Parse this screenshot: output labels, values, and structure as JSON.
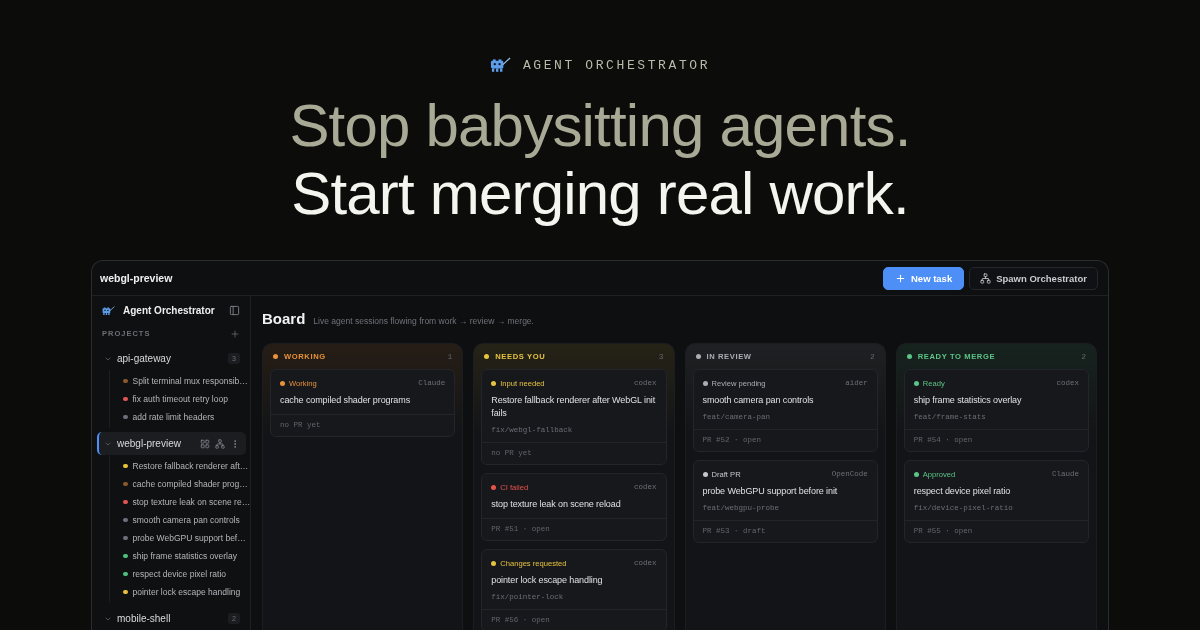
{
  "hero": {
    "brand": "AGENT ORCHESTRATOR",
    "headline": "Stop babysitting agents.",
    "subheadline": "Start merging real work."
  },
  "window": {
    "title": "webgl-preview",
    "buttons": [
      {
        "kind": "primary",
        "label": "New task"
      },
      {
        "kind": "secondary",
        "label": "Spawn Orchestrator"
      }
    ]
  },
  "sidebar": {
    "title": "Agent Orchestrator",
    "section": "PROJECTS",
    "projects": [
      {
        "name": "api-gateway",
        "count": "3",
        "selected": false,
        "sessions": [
          {
            "title": "Split terminal mux responsib…",
            "color": "#8c5a2e"
          },
          {
            "title": "fix auth timeout retry loop",
            "color": "#e05656"
          },
          {
            "title": "add rate limit headers",
            "color": "#6b707a"
          }
        ]
      },
      {
        "name": "webgl-preview",
        "selected": true,
        "sessions": [
          {
            "title": "Restore fallback renderer aft…",
            "color": "#e8c23a"
          },
          {
            "title": "cache compiled shader prog…",
            "color": "#8c5a2e"
          },
          {
            "title": "stop texture leak on scene re…",
            "color": "#e05656"
          },
          {
            "title": "smooth camera pan controls",
            "color": "#6b707a"
          },
          {
            "title": "probe WebGPU support bef…",
            "color": "#6b707a"
          },
          {
            "title": "ship frame statistics overlay",
            "color": "#4cc17c"
          },
          {
            "title": "respect device pixel ratio",
            "color": "#4cc17c"
          },
          {
            "title": "pointer lock escape handling",
            "color": "#e8c23a"
          }
        ]
      },
      {
        "name": "mobile-shell",
        "count": "2",
        "selected": false
      }
    ]
  },
  "board": {
    "title": "Board",
    "subtitle": "Live agent sessions flowing from work → review → merge.",
    "columns": [
      {
        "label": "WORKING",
        "count": "1",
        "color": "#e8913a",
        "cards": [
          {
            "status": "Working",
            "color": "#e8913a",
            "agent": "Claude",
            "title": "cache compiled shader programs",
            "footer": "no PR yet"
          }
        ]
      },
      {
        "label": "NEEDS YOU",
        "count": "3",
        "color": "#e6c33f",
        "cards": [
          {
            "status": "Input needed",
            "color": "#e6c33f",
            "agent": "codex",
            "title": "Restore fallback renderer after WebGL init fails",
            "branch": "fix/webgl-fallback",
            "footer": "no PR yet"
          },
          {
            "status": "CI failed",
            "color": "#e5534b",
            "agent": "codex",
            "title": "stop texture leak on scene reload",
            "footer": "PR #51 · open"
          },
          {
            "status": "Changes requested",
            "color": "#e6c33f",
            "agent": "codex",
            "title": "pointer lock escape handling",
            "branch": "fix/pointer-lock",
            "footer": "PR #56 · open"
          }
        ]
      },
      {
        "label": "IN REVIEW",
        "count": "2",
        "color": "#a9adb4",
        "cards": [
          {
            "status": "Review pending",
            "color": "#a9adb4",
            "agent": "aider",
            "title": "smooth camera pan controls",
            "branch": "feat/camera-pan",
            "footer": "PR #52 · open"
          },
          {
            "status": "Draft PR",
            "color": "#c4c7cc",
            "agent": "OpenCode",
            "title": "probe WebGPU support before init",
            "branch": "feat/webgpu-probe",
            "footer": "PR #53 · draft"
          }
        ]
      },
      {
        "label": "READY TO MERGE",
        "count": "2",
        "color": "#5cc486",
        "cards": [
          {
            "status": "Ready",
            "color": "#5cc486",
            "agent": "codex",
            "title": "ship frame statistics overlay",
            "branch": "feat/frame-stats",
            "footer": "PR #54 · open"
          },
          {
            "status": "Approved",
            "color": "#5cc486",
            "agent": "Claude",
            "title": "respect device pixel ratio",
            "branch": "fix/device-pixel-ratio",
            "footer": "PR #55 · open"
          }
        ]
      }
    ]
  }
}
